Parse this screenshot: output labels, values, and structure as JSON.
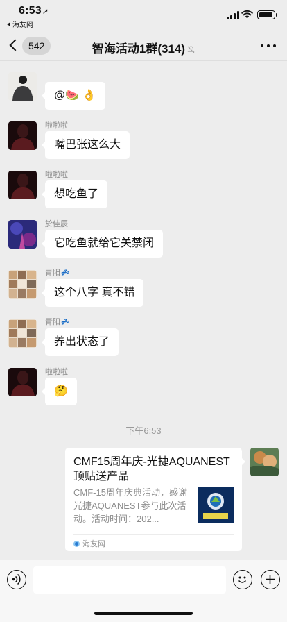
{
  "status_bar": {
    "time": "6:53",
    "back_app": "海友网"
  },
  "nav": {
    "back_count": "542",
    "title": "智海活动1群(314)"
  },
  "messages": [
    {
      "sender": "",
      "text": "@🍉 👌"
    },
    {
      "sender": "啦啦啦",
      "text": "嘴巴张这么大"
    },
    {
      "sender": "啦啦啦",
      "text": "想吃鱼了"
    },
    {
      "sender": "於佳辰",
      "text": "它吃鱼就给它关禁闭"
    },
    {
      "sender": "青阳",
      "sender_emoji": "💤",
      "text": "这个八字 真不错"
    },
    {
      "sender": "青阳",
      "sender_emoji": "💤",
      "text": "养出状态了"
    },
    {
      "sender": "啦啦啦",
      "text": "🤔"
    }
  ],
  "timestamp": "下午6:53",
  "link_card": {
    "title": "CMF15周年庆-光捷AQUANEST顶贴送产品",
    "description": "CMF-15周年庆典活动，感谢光捷AQUANEST参与此次活动。活动时间：202...",
    "source": "海友网"
  },
  "colors": {
    "background": "#ededed",
    "bubble": "#ffffff",
    "link": "#2b6be0"
  }
}
